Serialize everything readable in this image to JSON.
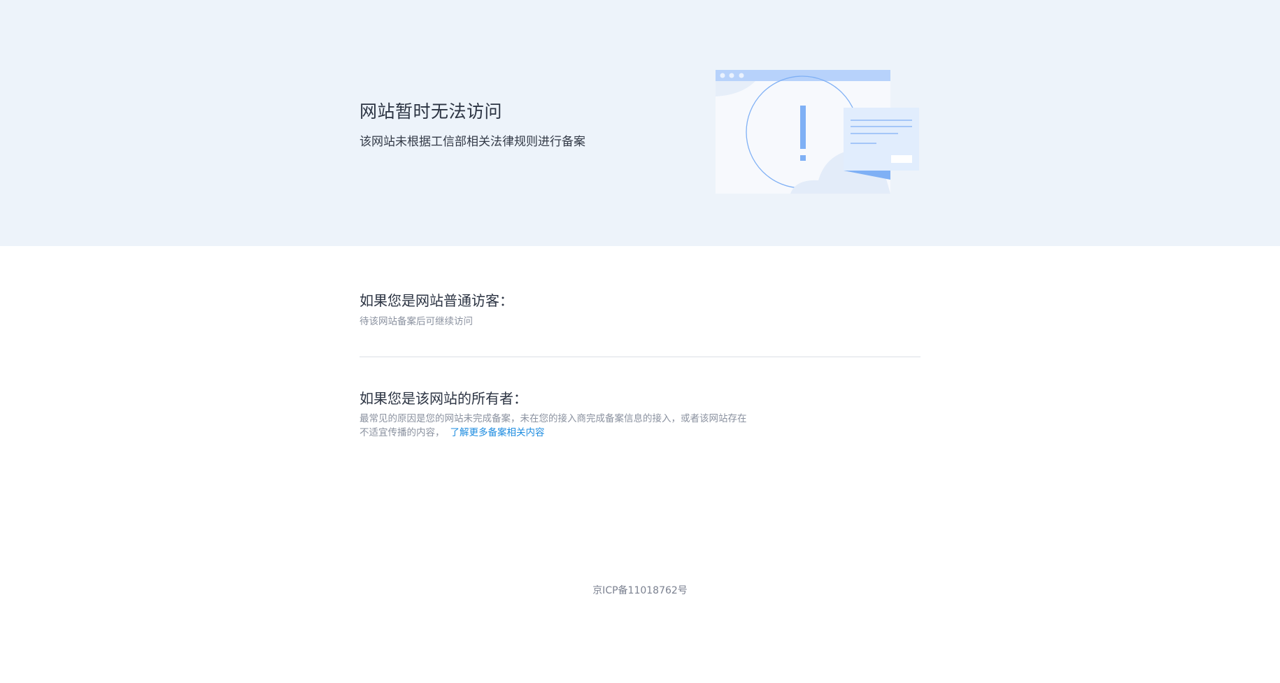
{
  "hero": {
    "title": "网站暂时无法访问",
    "subtitle": "该网站未根据工信部相关法律规则进行备案",
    "illustration": "browser-warning-illustration",
    "accent_color": "#7fb0f5"
  },
  "visitor": {
    "title": "如果您是网站普通访客：",
    "text": "待该网站备案后可继续访问"
  },
  "owner": {
    "title": "如果您是该网站的所有者：",
    "text_line1": "最常见的原因是您的网站未完成备案，未在您的接入商完成备案信息的接入，或者该网站存在",
    "text_line2": "不适宜传播的内容，",
    "link_label": "了解更多备案相关内容"
  },
  "footer": {
    "icp": "京ICP备11018762号"
  },
  "colors": {
    "hero_bg": "#edf3fa",
    "link": "#1d8ce0",
    "muted_text": "#8a919f"
  }
}
